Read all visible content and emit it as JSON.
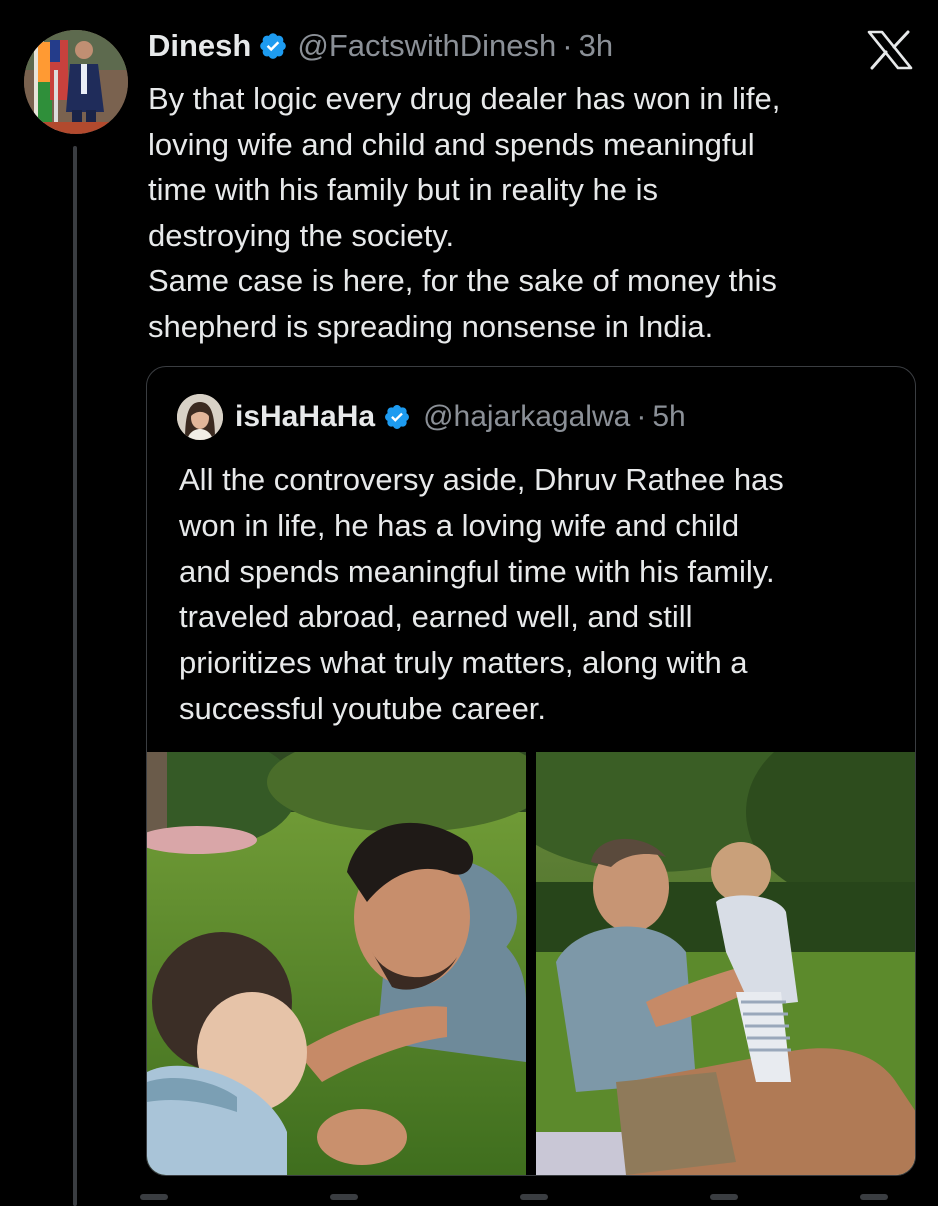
{
  "tweet": {
    "author_name": "Dinesh",
    "handle": "@FactswithDinesh",
    "separator": "·",
    "time": "3h",
    "text": "By that logic every drug dealer has won in life,\nloving wife and child and spends meaningful\ntime with his family but in reality he is\ndestroying the society.\nSame case is here, for the sake of money this\nshepherd is spreading nonsense in India."
  },
  "quoted_tweet": {
    "author_name": "isHaHaHa",
    "handle": "@hajarkagalwa",
    "separator": "·",
    "time": "5h",
    "text": "All the controversy aside, Dhruv Rathee has\nwon in life, he has a loving wife and child\nand spends meaningful time with his family.\ntraveled abroad, earned well, and still\nprioritizes what truly matters, along with a\nsuccessful youtube career."
  },
  "icons": {
    "verified": "verified-badge-icon",
    "platform": "x-logo-icon"
  },
  "colors": {
    "background": "#000000",
    "text": "#e7e9ea",
    "secondary_text": "#8b9097",
    "verified": "#1d9bf0",
    "border": "#3a3d41"
  }
}
